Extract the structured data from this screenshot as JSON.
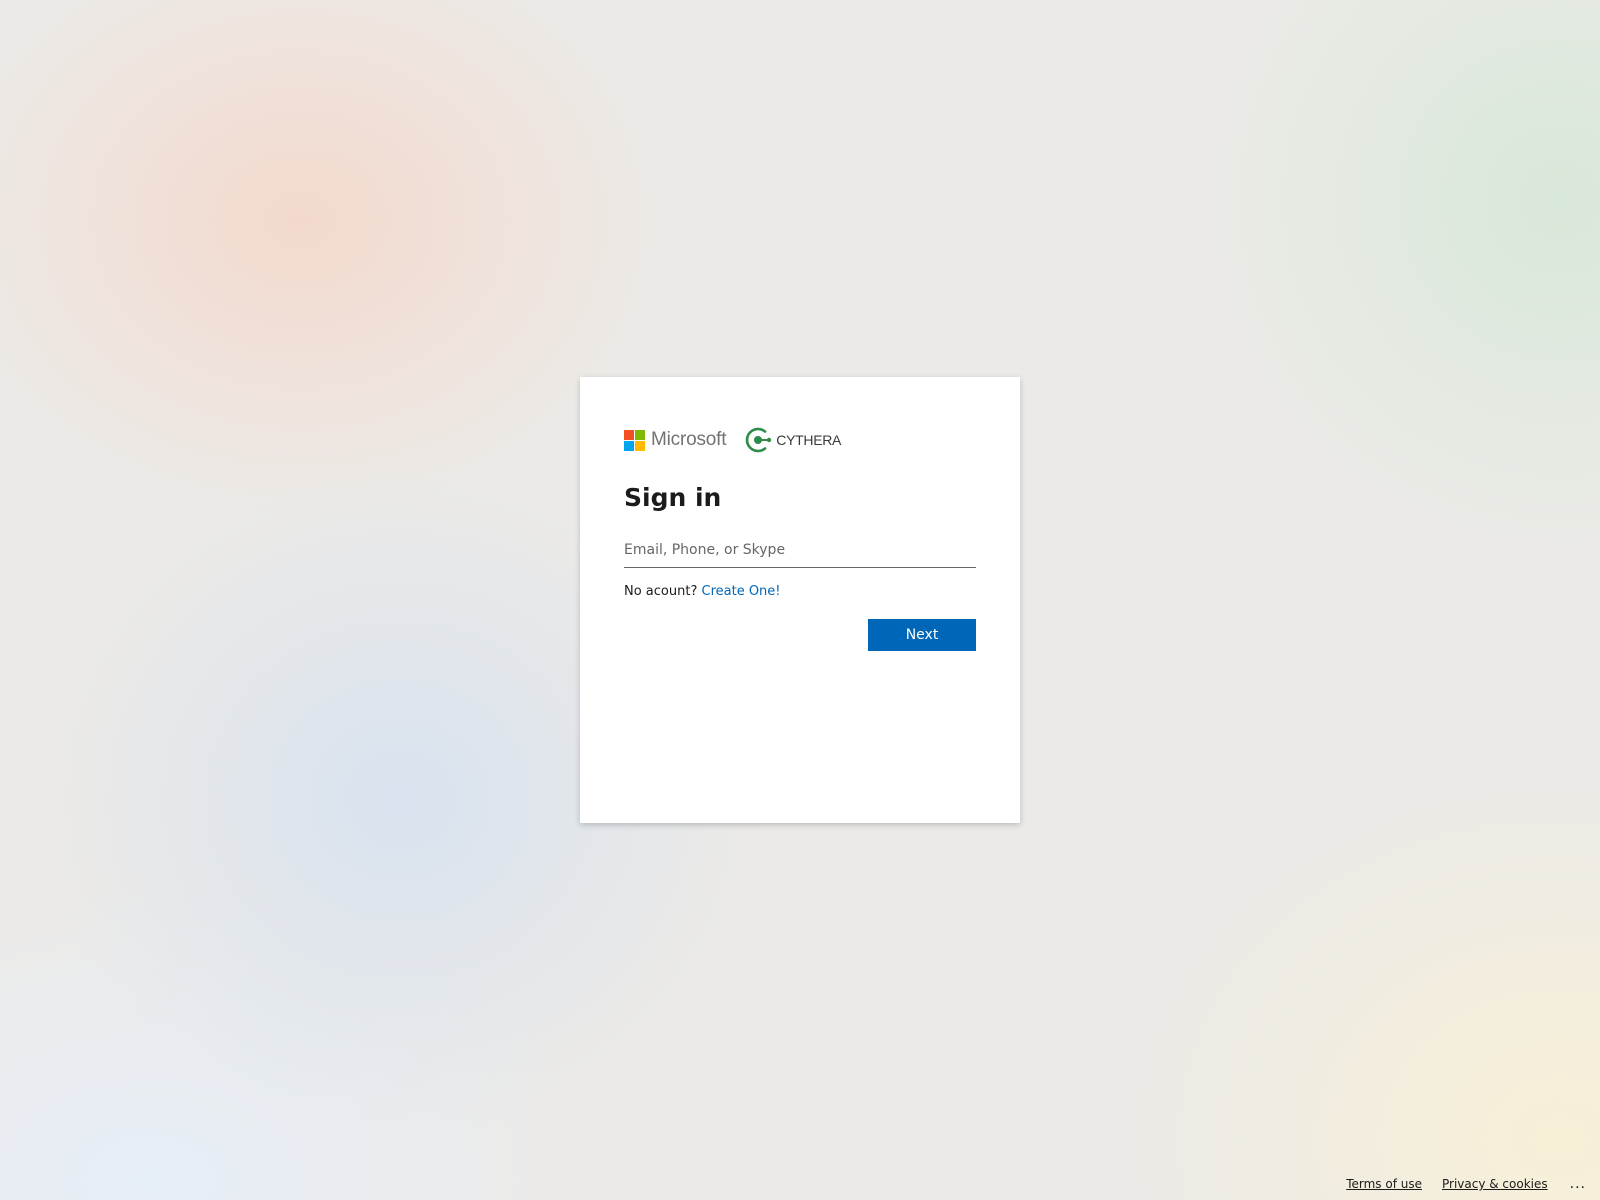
{
  "logos": {
    "microsoft": {
      "wordmark": "Microsoft",
      "colors": [
        "#f25022",
        "#7fba00",
        "#00a4ef",
        "#ffb900"
      ]
    },
    "partner": {
      "wordmark": "CYTHERA",
      "color": "#2e8b47"
    }
  },
  "title": "Sign in",
  "email_field": {
    "value": "",
    "placeholder": "Email, Phone, or Skype"
  },
  "no_account": {
    "prompt": "No acount?",
    "link": "Create One!"
  },
  "next_button": "Next",
  "footer": {
    "terms": "Terms of use",
    "privacy": "Privacy & cookies",
    "more": "..."
  },
  "colors": {
    "accent": "#0067b8",
    "text": "#1b1b1b",
    "placeholder": "#666666"
  }
}
